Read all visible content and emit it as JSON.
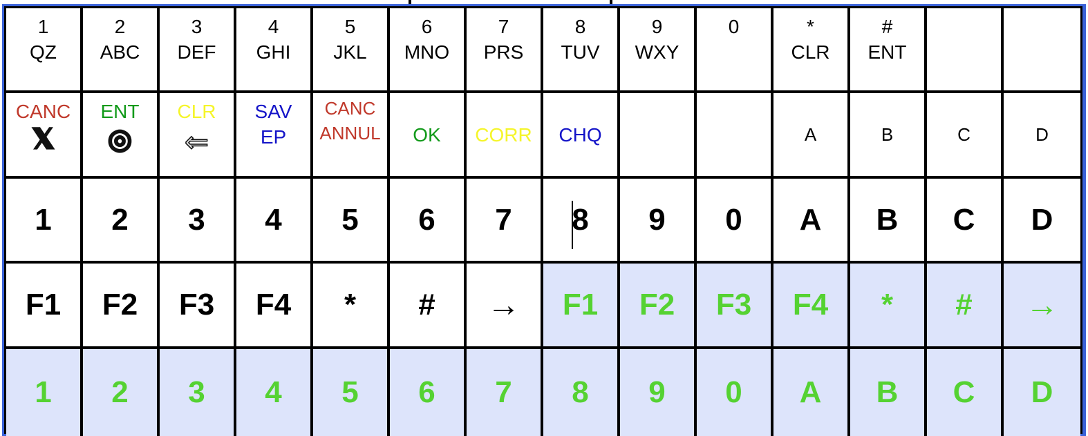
{
  "colors": {
    "frame_border": "#3a62d8",
    "shaded_bg": "#dde4fb",
    "green_text": "#55d232",
    "canc": "#c0392b",
    "ent": "#129a1a",
    "clr": "#f5f52a",
    "sav": "#1414c8"
  },
  "row1": [
    {
      "top": "1",
      "bottom": "QZ"
    },
    {
      "top": "2",
      "bottom": "ABC"
    },
    {
      "top": "3",
      "bottom": "DEF"
    },
    {
      "top": "4",
      "bottom": "GHI"
    },
    {
      "top": "5",
      "bottom": "JKL"
    },
    {
      "top": "6",
      "bottom": "MNO"
    },
    {
      "top": "7",
      "bottom": "PRS"
    },
    {
      "top": "8",
      "bottom": "TUV"
    },
    {
      "top": "9",
      "bottom": "WXY"
    },
    {
      "top": "0",
      "bottom": ""
    },
    {
      "top": "*",
      "bottom": "CLR"
    },
    {
      "top": "#",
      "bottom": "ENT"
    },
    {
      "top": "",
      "bottom": ""
    },
    {
      "top": "",
      "bottom": ""
    }
  ],
  "row2": [
    {
      "label": "CANC",
      "symbol": "𝕏",
      "icon": "cancel-x-icon"
    },
    {
      "label": "ENT",
      "symbol": "◎",
      "icon": "enter-o-icon"
    },
    {
      "label": "CLR",
      "symbol": "⇐",
      "icon": "clear-arrow-left-icon"
    },
    {
      "label": "SAV",
      "label2": "EP"
    },
    {
      "label": "CANC",
      "label2": "ANNUL"
    },
    {
      "label": "OK"
    },
    {
      "label": "CORR"
    },
    {
      "label": "CHQ"
    },
    {
      "label": ""
    },
    {
      "label": ""
    },
    {
      "label": "A"
    },
    {
      "label": "B"
    },
    {
      "label": "C"
    },
    {
      "label": "D"
    }
  ],
  "row3": [
    "1",
    "2",
    "3",
    "4",
    "5",
    "6",
    "7",
    "8",
    "9",
    "0",
    "A",
    "B",
    "C",
    "D"
  ],
  "row4": [
    "F1",
    "F2",
    "F3",
    "F4",
    "*",
    "#",
    "→",
    "F1",
    "F2",
    "F3",
    "F4",
    "*",
    "#",
    "→"
  ],
  "row5": [
    "1",
    "2",
    "3",
    "4",
    "5",
    "6",
    "7",
    "8",
    "9",
    "0",
    "A",
    "B",
    "C",
    "D"
  ]
}
